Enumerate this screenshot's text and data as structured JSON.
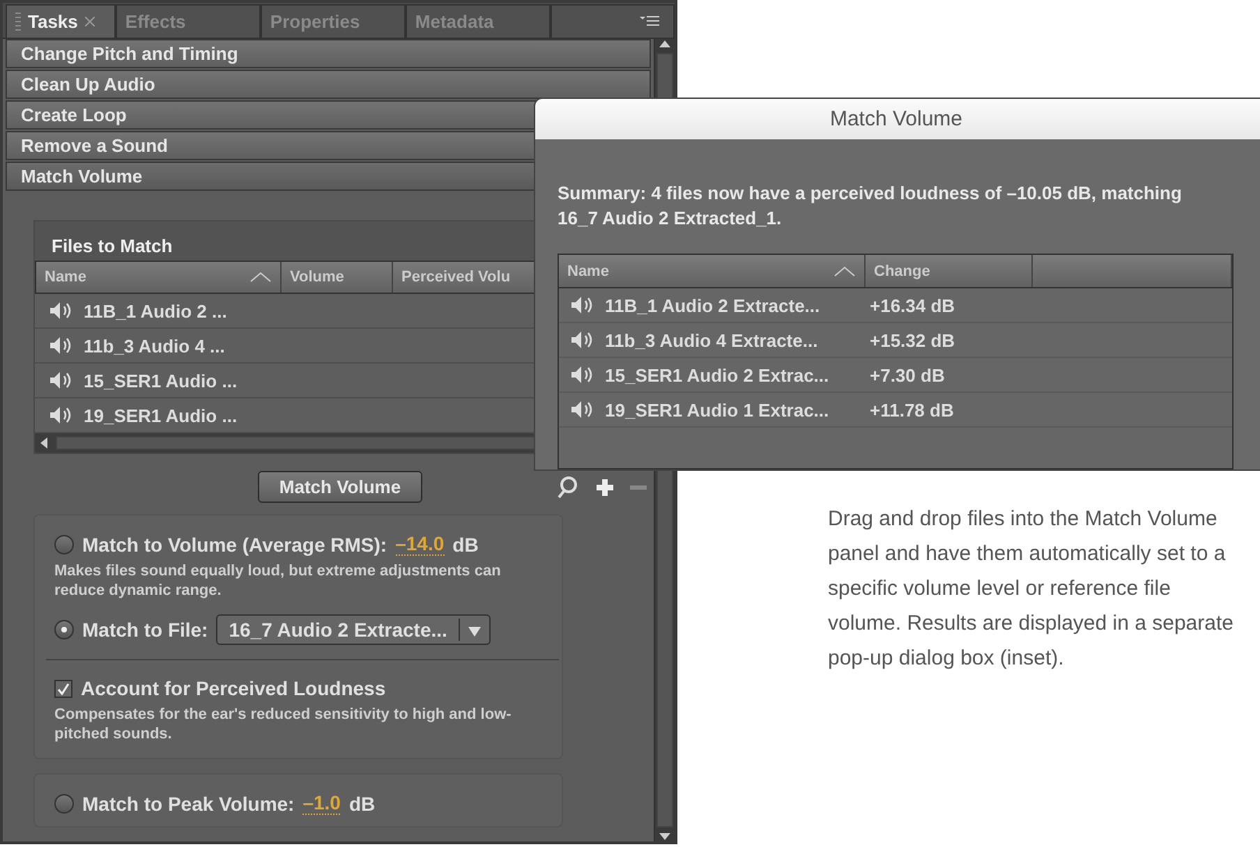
{
  "panel": {
    "tabs": [
      {
        "label": "Tasks",
        "selected": true,
        "closable": true
      },
      {
        "label": "Effects",
        "selected": false,
        "closable": false
      },
      {
        "label": "Properties",
        "selected": false,
        "closable": false
      },
      {
        "label": "Metadata",
        "selected": false,
        "closable": false
      }
    ],
    "sections": [
      {
        "label": "Change Pitch and Timing",
        "expanded": false
      },
      {
        "label": "Clean Up Audio",
        "expanded": false
      },
      {
        "label": "Create Loop",
        "expanded": false
      },
      {
        "label": "Remove a Sound",
        "expanded": false
      },
      {
        "label": "Match Volume",
        "expanded": true
      }
    ],
    "files_to_match": {
      "title": "Files to Match",
      "columns": [
        "Name",
        "Volume",
        "Perceived Volu"
      ],
      "rows": [
        "11B_1 Audio 2 ...",
        "11b_3 Audio 4 ...",
        "15_SER1 Audio ...",
        "19_SER1 Audio ..."
      ]
    },
    "match_button": "Match Volume",
    "option_groups": [
      {
        "options": [
          {
            "kind": "radio",
            "label": "Match to Volume (Average RMS):",
            "value": "–14.0",
            "unit": "dB",
            "selected": false,
            "description": "Makes files sound equally loud, but extreme adjustments can reduce dynamic range."
          },
          {
            "kind": "file",
            "label": "Match to File:",
            "value": "16_7 Audio 2 Extracte...",
            "selected": true
          },
          {
            "kind": "checkbox",
            "label": "Account for Perceived Loudness",
            "checked": true,
            "description": "Compensates for the ear's reduced sensitivity to high and low-pitched sounds."
          }
        ]
      },
      {
        "options": [
          {
            "kind": "radio",
            "label": "Match to Peak Volume:",
            "value": "–1.0",
            "unit": "dB",
            "selected": false
          }
        ]
      }
    ]
  },
  "dialog": {
    "title": "Match Volume",
    "summary": "Summary: 4 files now have a perceived loudness of –10.05 dB, matching 16_7 Audio 2 Extracted_1.",
    "columns": [
      "Name",
      "Change"
    ],
    "rows": [
      {
        "name": "11B_1 Audio 2 Extracte...",
        "change": "+16.34 dB"
      },
      {
        "name": "11b_3 Audio 4 Extracte...",
        "change": "+15.32 dB"
      },
      {
        "name": "15_SER1 Audio 2 Extrac...",
        "change": "+7.30 dB"
      },
      {
        "name": "19_SER1 Audio 1 Extrac...",
        "change": "+11.78 dB"
      }
    ]
  },
  "caption": "Drag and drop files into the Match Volume panel and have them automatically set to a specific volume level or reference file volume. Results are displayed in a separate pop-up dialog box (inset)."
}
